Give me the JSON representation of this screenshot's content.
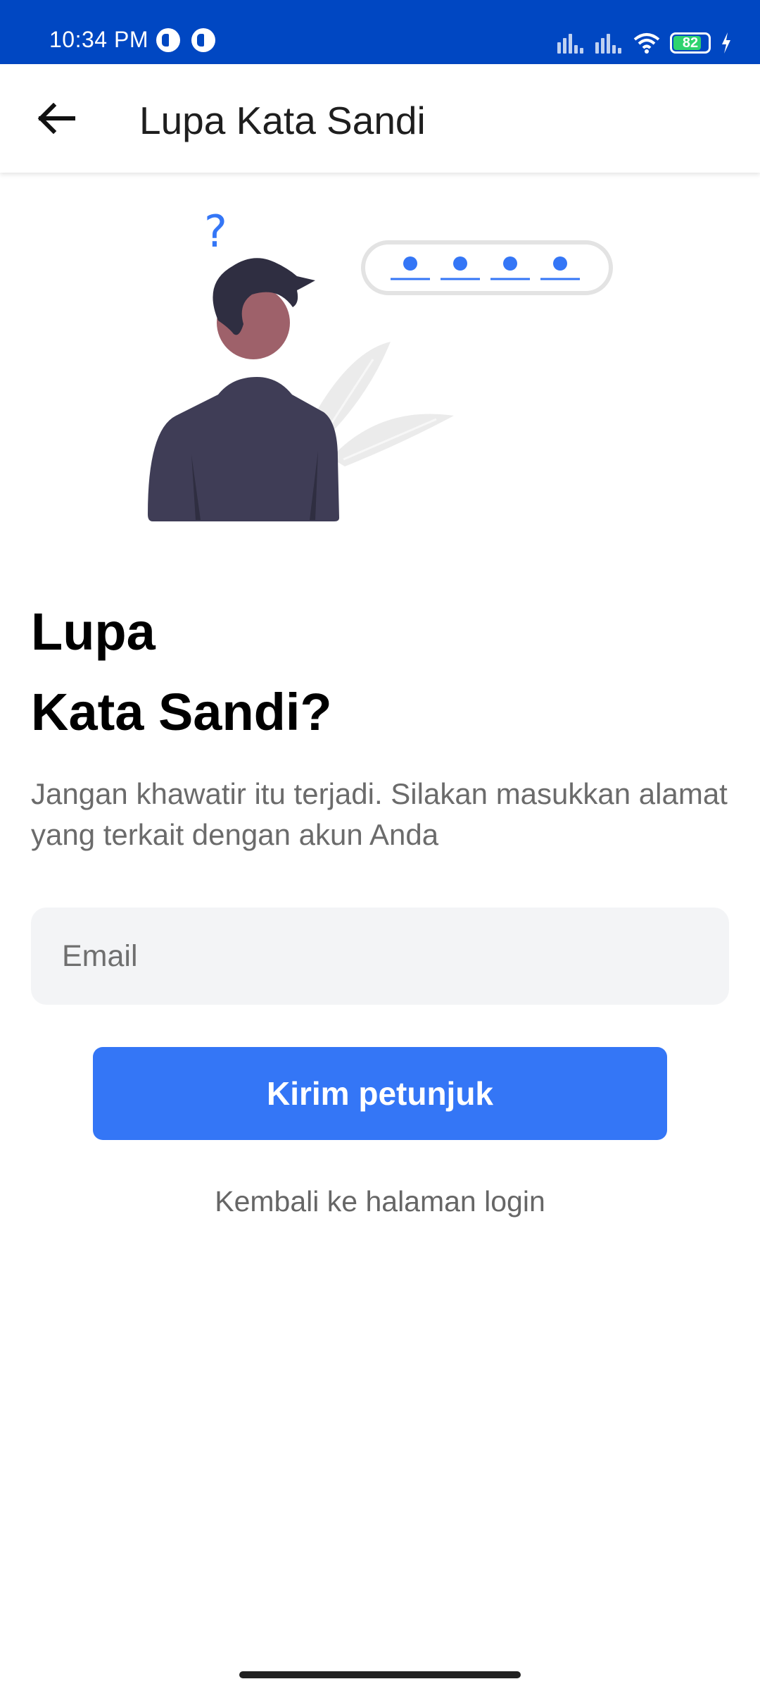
{
  "status_bar": {
    "time": "10:34 PM",
    "battery_level": "82",
    "battery_fraction": 0.82,
    "icons": [
      "app-notification-icon",
      "app-notification-icon",
      "signal-icon",
      "signal-icon",
      "wifi-icon",
      "battery-icon",
      "charging-icon"
    ]
  },
  "app_bar": {
    "title": "Lupa Kata Sandi",
    "back_icon": "arrow-left-icon"
  },
  "illustration": {
    "question_mark": "?",
    "pin_dot_count": 4
  },
  "main": {
    "heading_line1": "Lupa",
    "heading_line2": "Kata Sandi?",
    "description": "Jangan khawatir itu terjadi. Silakan masukkan alamat yang terkait dengan akun Anda",
    "email_placeholder": "Email",
    "submit_label": "Kirim petunjuk",
    "back_link": "Kembali ke halaman login"
  },
  "colors": {
    "status_bar": "#0047c2",
    "primary": "#3476f6",
    "input_bg": "#f3f4f6",
    "figure_body": "#3f3d56",
    "figure_skin": "#9e616a"
  }
}
